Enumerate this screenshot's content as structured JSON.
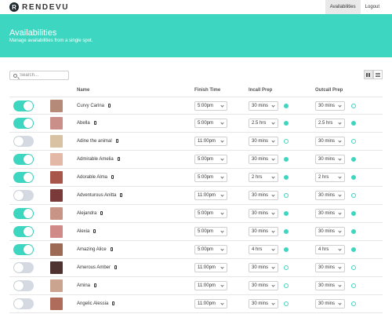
{
  "brand": {
    "mark": "R",
    "name": "RENDEVU"
  },
  "nav": {
    "availabilities": "Availabilities",
    "logout": "Logout"
  },
  "hero": {
    "title": "Availabilities",
    "subtitle": "Manage availabilities from a single spot."
  },
  "search": {
    "placeholder": "Search..."
  },
  "colors": {
    "accent": "#3dd6c0",
    "toggle_off": "#d5d9e1"
  },
  "table": {
    "headers": {
      "name": "Name",
      "finish": "Finish Time",
      "incall": "Incall Prep",
      "outcall": "Outcall Prep"
    },
    "rows": [
      {
        "enabled": true,
        "name": "Curvy Carina",
        "finish": "5:00pm",
        "incall": "30 mins",
        "incall_on": true,
        "outcall": "30 mins",
        "outcall_on": false,
        "avatar": "#b58a78"
      },
      {
        "enabled": true,
        "name": "Abella",
        "finish": "5:00pm",
        "incall": "2.5 hrs",
        "incall_on": true,
        "outcall": "2.5 hrs",
        "outcall_on": true,
        "avatar": "#c98f88"
      },
      {
        "enabled": false,
        "name": "Adine the animal",
        "finish": "11:00pm",
        "incall": "30 mins",
        "incall_on": false,
        "outcall": "30 mins",
        "outcall_on": false,
        "avatar": "#d9c2a4"
      },
      {
        "enabled": true,
        "name": "Admirable Amelia",
        "finish": "5:00pm",
        "incall": "30 mins",
        "incall_on": true,
        "outcall": "30 mins",
        "outcall_on": true,
        "avatar": "#e3b8a6"
      },
      {
        "enabled": true,
        "name": "Adorable Alma",
        "finish": "5:00pm",
        "incall": "2 hrs",
        "incall_on": true,
        "outcall": "2 hrs",
        "outcall_on": true,
        "avatar": "#a8564a"
      },
      {
        "enabled": false,
        "name": "Adventurous Anitta",
        "finish": "11:00pm",
        "incall": "30 mins",
        "incall_on": false,
        "outcall": "30 mins",
        "outcall_on": false,
        "avatar": "#7a3a3a"
      },
      {
        "enabled": true,
        "name": "Alejandra",
        "finish": "5:00pm",
        "incall": "30 mins",
        "incall_on": true,
        "outcall": "30 mins",
        "outcall_on": true,
        "avatar": "#c79486"
      },
      {
        "enabled": true,
        "name": "Alexia",
        "finish": "5:00pm",
        "incall": "30 mins",
        "incall_on": true,
        "outcall": "30 mins",
        "outcall_on": true,
        "avatar": "#d08a88"
      },
      {
        "enabled": true,
        "name": "Amazing Alice",
        "finish": "5:00pm",
        "incall": "4 hrs",
        "incall_on": true,
        "outcall": "4 hrs",
        "outcall_on": true,
        "avatar": "#9c6a55"
      },
      {
        "enabled": false,
        "name": "Amerous Amber",
        "finish": "11:00pm",
        "incall": "30 mins",
        "incall_on": false,
        "outcall": "30 mins",
        "outcall_on": false,
        "avatar": "#4e3330"
      },
      {
        "enabled": false,
        "name": "Amina",
        "finish": "11:00pm",
        "incall": "30 mins",
        "incall_on": false,
        "outcall": "30 mins",
        "outcall_on": false,
        "avatar": "#caa48e"
      },
      {
        "enabled": false,
        "name": "Angelic Alessia",
        "finish": "11:00pm",
        "incall": "30 mins",
        "incall_on": false,
        "outcall": "30 mins",
        "outcall_on": false,
        "avatar": "#b06c5a"
      }
    ]
  }
}
